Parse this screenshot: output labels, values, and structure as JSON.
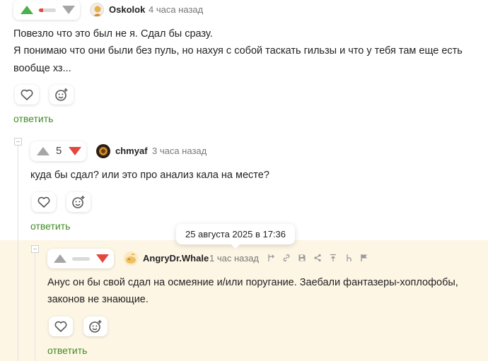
{
  "comments": [
    {
      "author": "Oskolok",
      "time": "4 часа назад",
      "rating": "",
      "text_lines": [
        "Повезло что это был не я. Сдал бы сразу.",
        "Я понимаю что они были без пуль, но нахуя с собой таскать гильзы и что у тебя там еще есть",
        "вообще хз..."
      ],
      "reply_label": "ответить"
    },
    {
      "author": "chmyaf",
      "time": "3 часа назад",
      "rating": "5",
      "text_lines": [
        "куда бы сдал? или это про анализ кала на месте?"
      ],
      "reply_label": "ответить"
    },
    {
      "author": "AngryDr.Whale",
      "time": "1 час назад",
      "rating": "",
      "text_lines": [
        "Анус он бы свой сдал на осмеяние и/или поругание. Заебали фантазеры-хоплофобы,",
        "законов не знающие."
      ],
      "reply_label": "ответить",
      "tooltip": "25 августа 2025 в 17:36"
    }
  ],
  "vote_bars": [
    {
      "up_share": 0.25
    },
    {
      "up_share": 0.0
    }
  ],
  "colors": {
    "upvote": "#4caf50",
    "downvote": "#e5473d",
    "reply_link": "#3f8b24",
    "highlight_bg": "#fdf6e5"
  },
  "icons": [
    "heart-icon",
    "smile-add-icon",
    "branch-icon",
    "link-icon",
    "save-icon",
    "share-icon",
    "scroll-up-icon",
    "tree-icon",
    "flag-icon"
  ]
}
